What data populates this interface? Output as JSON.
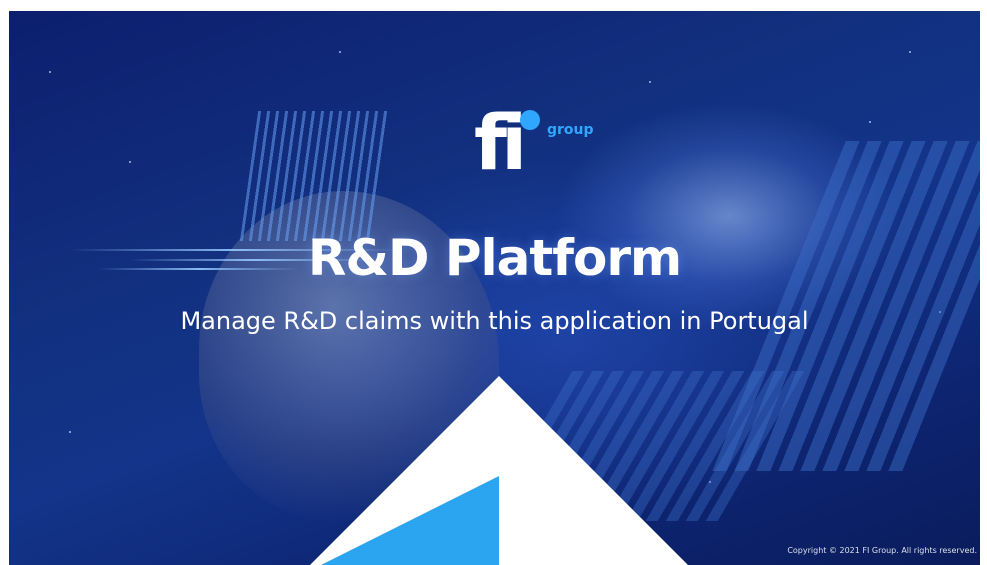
{
  "brand": {
    "logo_letters": "fi",
    "logo_sub": "group",
    "accent_color": "#2fa6ff",
    "bg_color": "#12307f"
  },
  "hero": {
    "title": "R&D Platform",
    "subtitle": "Manage R&D claims with this application in Portugal",
    "copyright": "Copyright © 2021 FI Group. All rights reserved."
  }
}
